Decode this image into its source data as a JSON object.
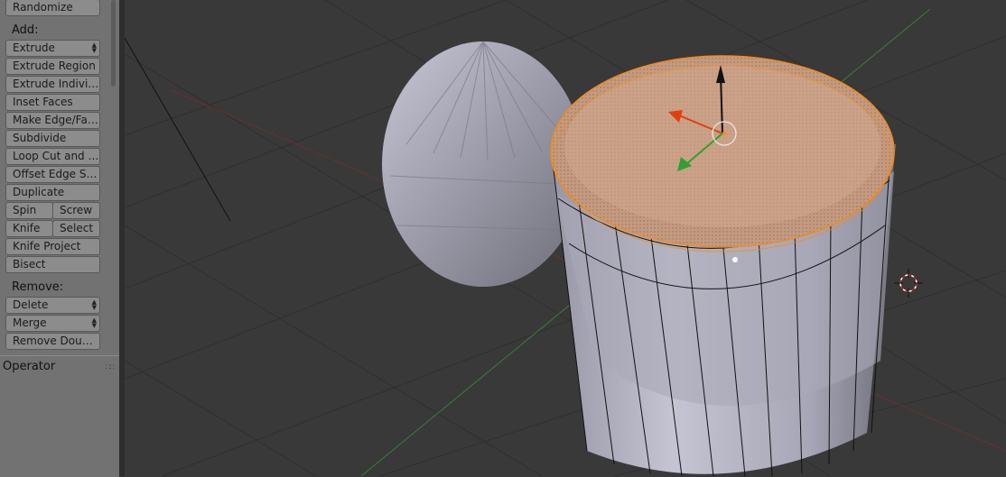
{
  "toolshelf": {
    "top_button": "Randomize",
    "add_section": {
      "label": "Add:",
      "buttons": [
        "Extrude",
        "Extrude Region",
        "Extrude Individ...",
        "Inset Faces",
        "Make Edge/Face",
        "Subdivide",
        "Loop Cut and S...",
        "Offset Edge Sli...",
        "Duplicate"
      ],
      "spin": "Spin",
      "screw": "Screw",
      "knife": "Knife",
      "select": "Select",
      "knife_project": "Knife Project",
      "bisect": "Bisect"
    },
    "remove_section": {
      "label": "Remove:",
      "delete": "Delete",
      "merge": "Merge",
      "remove_doubles": "Remove Doubl..."
    }
  },
  "operator_panel": {
    "title": "Operator",
    "grip_icon": "drag-grip-icon"
  },
  "viewport": {
    "background": "#393939",
    "selection_color": "#f28a1a",
    "objects": [
      "sphere",
      "cylinder"
    ],
    "cursor_icon": "3d-cursor-icon",
    "manipulator_icon": "transform-manipulator-icon"
  }
}
